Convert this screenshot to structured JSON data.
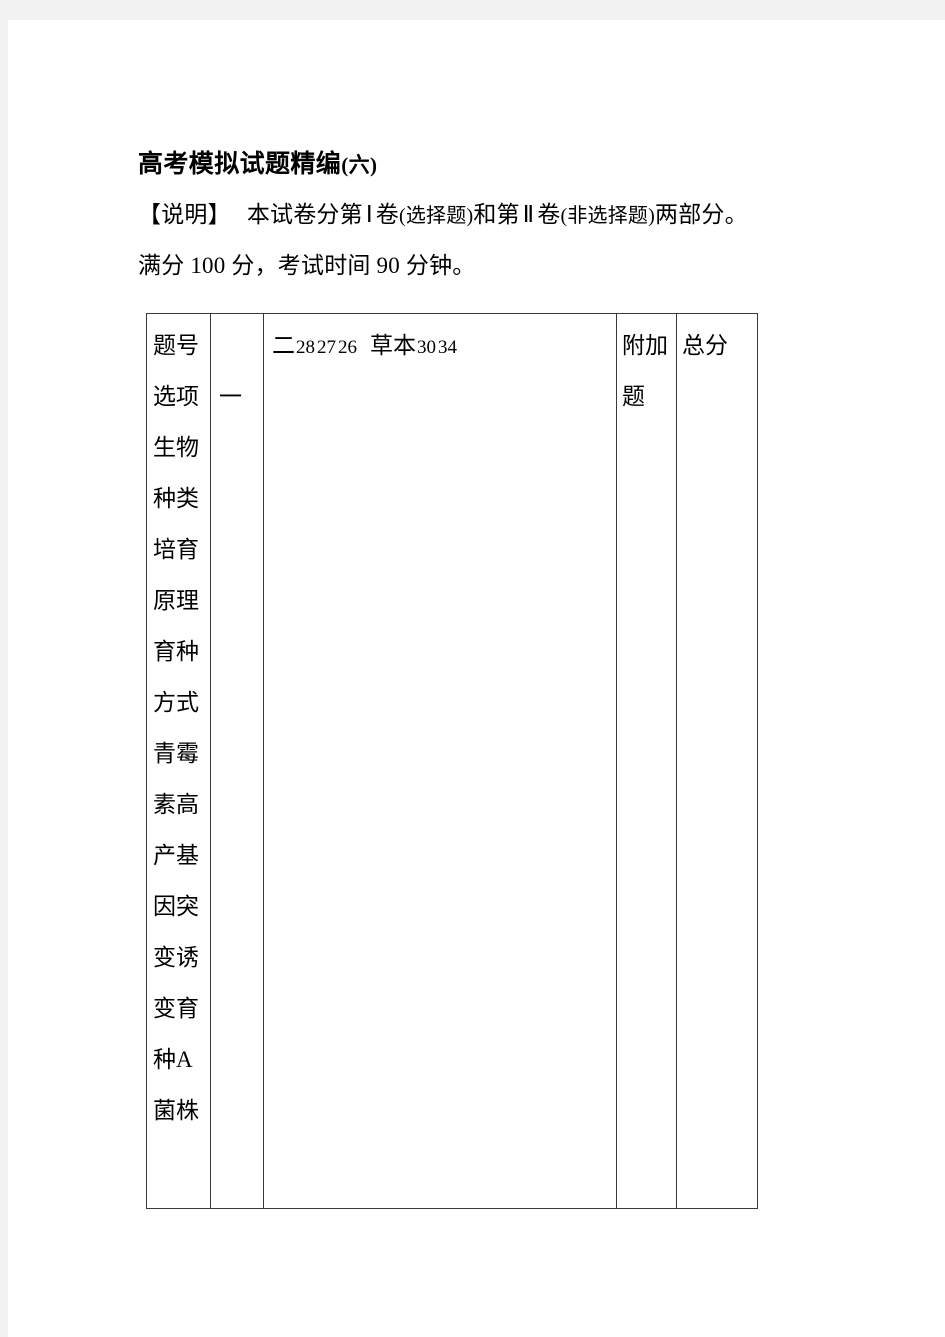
{
  "document": {
    "title": "高考模拟试题精编",
    "title_index": "(六)",
    "note_label": "【说明】",
    "note_text_1": "本试卷分第",
    "note_roman_1": "Ⅰ",
    "note_text_2": "卷",
    "note_paren_1": "(选择题)",
    "note_text_3": "和第",
    "note_roman_2": "Ⅱ",
    "note_text_4": "卷",
    "note_paren_2": "(非选择题)",
    "note_text_5": "两部分。",
    "score_line": "满分 100 分，考试时间 90 分钟。"
  },
  "score_table": {
    "columns": [
      {
        "name": "items",
        "text": "题号选项生物种类培育原理育种方式青霉素高产基因突变诱变育种A 菌株"
      },
      {
        "name": "section-one",
        "text": "一"
      },
      {
        "name": "section-two",
        "parts": [
          "二",
          "28",
          "27",
          "26",
          "草本",
          "30",
          "34"
        ]
      },
      {
        "name": "extra-question",
        "text": "附加题"
      },
      {
        "name": "total-score",
        "text": "总分"
      }
    ]
  }
}
